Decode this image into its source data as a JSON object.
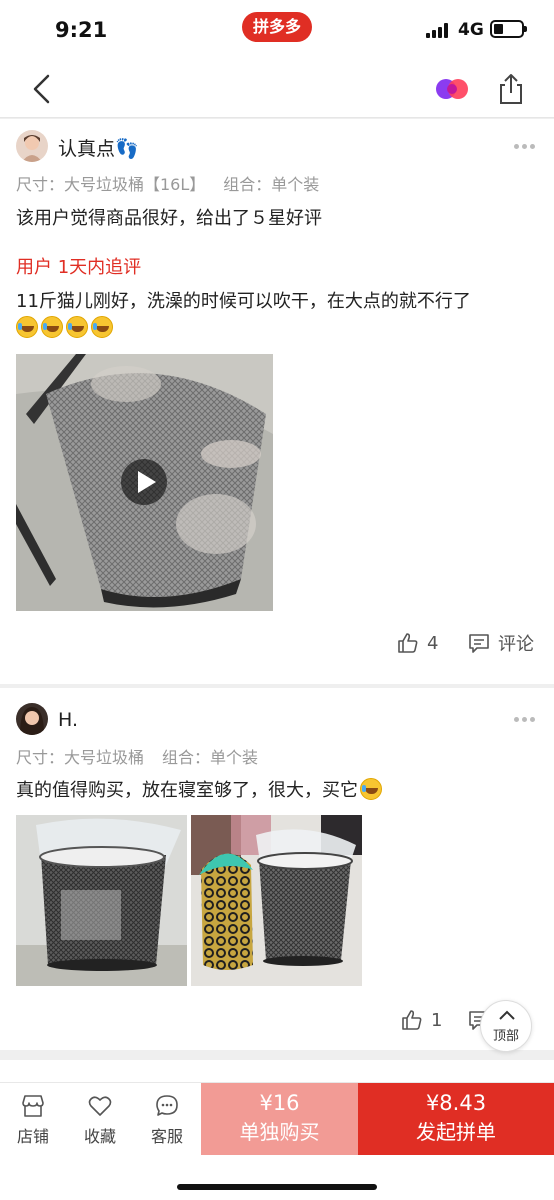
{
  "status_bar": {
    "time": "9:21",
    "app_badge": "拼多多",
    "network": "4G"
  },
  "reviews": [
    {
      "username": "认真点👣",
      "spec_size_label": "尺寸：大号垃圾桶【16L】",
      "spec_combo_label": "组合：单个装",
      "text": "该用户觉得商品很好，给出了５星好评",
      "follow_up_label": "用户 1天内追评",
      "follow_up_text": "11斤猫儿刚好，洗澡的时候可以吹干，在大点的就不行了",
      "like_count": "4",
      "comment_label": "评论"
    },
    {
      "username": "H.",
      "spec_size_label": "尺寸：大号垃圾桶",
      "spec_combo_label": "组合：单个装",
      "text": "真的值得购买，放在寝室够了，很大，买它",
      "like_count": "1"
    }
  ],
  "back_to_top_label": "顶部",
  "bottom_bar": {
    "store_label": "店铺",
    "favorite_label": "收藏",
    "service_label": "客服",
    "single_price": "¥16",
    "single_label": "单独购买",
    "group_price": "¥8.43",
    "group_label": "发起拼单"
  },
  "colors": {
    "accent": "#e02e24",
    "single_button": "#f29b95"
  }
}
